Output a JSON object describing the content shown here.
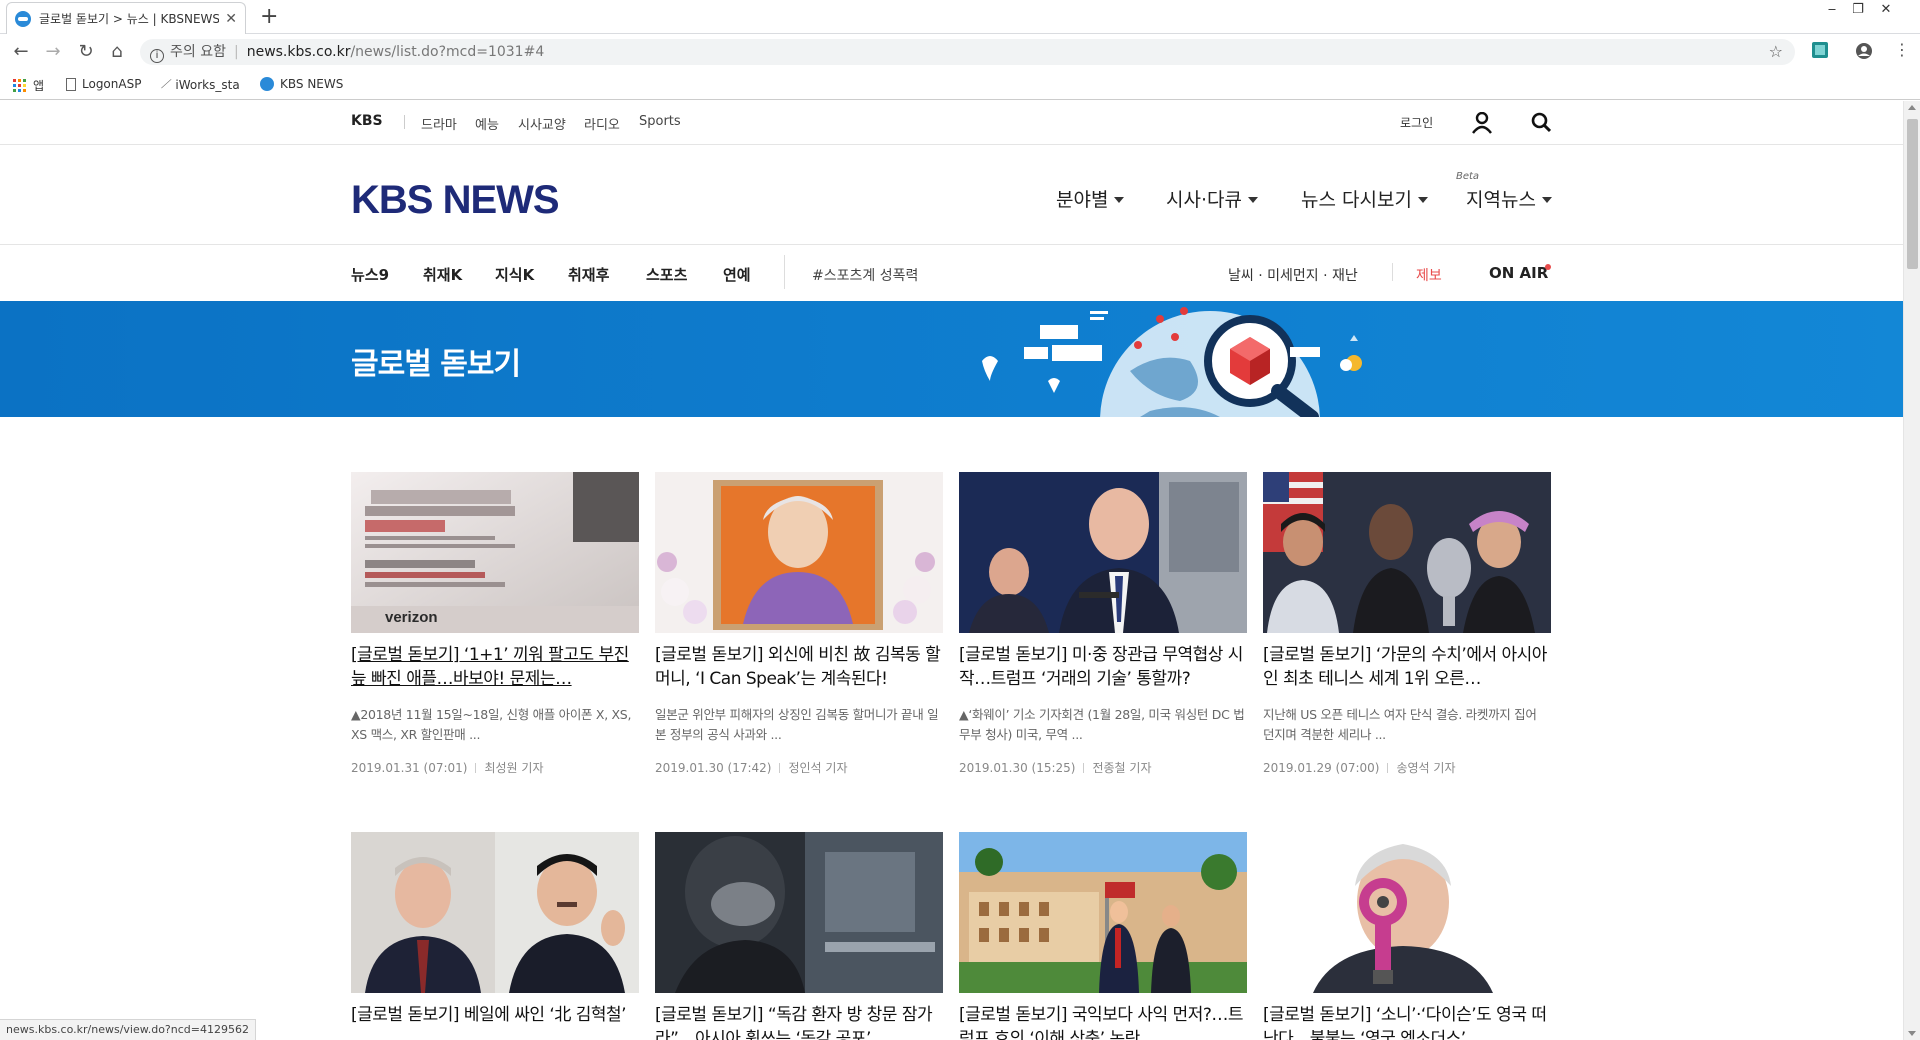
{
  "browser": {
    "tab_title": "글로벌 돋보기 > 뉴스 | KBSNEWS",
    "new_tab_symbol": "+",
    "url_warning": "주의 요함",
    "url_host": "news.kbs.co.kr",
    "url_path": "/news/list.do?mcd=1031#4",
    "bookmarks": [
      "앱",
      "LogonASP",
      "iWorks_sta",
      "KBS NEWS"
    ],
    "status_url": "news.kbs.co.kr/news/view.do?ncd=4129562"
  },
  "utility": {
    "brand": "KBS",
    "categories": [
      "드라마",
      "예능",
      "시사교양",
      "라디오",
      "Sports"
    ],
    "login": "로그인"
  },
  "brand": {
    "logo": "KBS NEWS",
    "main_nav": [
      "분야별",
      "시사·다큐",
      "뉴스 다시보기",
      "지역뉴스"
    ],
    "beta_label": "Beta"
  },
  "subnav": {
    "items": [
      "뉴스9",
      "취재K",
      "지식K",
      "취재후",
      "스포츠",
      "연예"
    ],
    "tag": "#스포츠계 성폭력",
    "weather": "날씨 · 미세먼지 · 재난",
    "report": "제보",
    "onair": "ON AIR"
  },
  "banner": {
    "title": "글로벌 돋보기"
  },
  "articles": [
    {
      "title": "[글로벌 돋보기] ‘1+1’ 끼워 팔고도 부진 늪 빠진 애플…바보야! 문제는…",
      "summary": "▲2018년 11월 15일~18일, 신형 애플 아이폰 X, XS, XS 맥스, XR 할인판매 ...",
      "date": "2019.01.31 (07:01)",
      "reporter": "최성원 기자"
    },
    {
      "title": "[글로벌 돋보기] 외신에 비친 故 김복동 할머니, ‘I Can Speak’는 계속된다!",
      "summary": "일본군 위안부 피해자의 상징인 김복동 할머니가 끝내 일본 정부의 공식 사과와 ...",
      "date": "2019.01.30 (17:42)",
      "reporter": "정인석 기자"
    },
    {
      "title": "[글로벌 돋보기] 미·중 장관급 무역협상 시작…트럼프 ‘거래의 기술’ 통할까?",
      "summary": "▲‘화웨이’ 기소 기자회견 (1월 28일, 미국 워싱턴 DC 법무부 청사) 미국, 무역 ...",
      "date": "2019.01.30 (15:25)",
      "reporter": "전종철 기자"
    },
    {
      "title": "[글로벌 돋보기] ‘가문의 수치’에서 아시아인 최초 테니스 세계 1위 오른…",
      "summary": "지난해 US 오픈 테니스 여자 단식 결승. 라켓까지 집어 던지며 격분한 세리나 ...",
      "date": "2019.01.29 (07:00)",
      "reporter": "송영석 기자"
    },
    {
      "title": "[글로벌 돋보기] 베일에 싸인 ‘北 김혁철’",
      "summary": "",
      "date": "",
      "reporter": ""
    },
    {
      "title": "[글로벌 돋보기] “독감 환자 방 창문 잠가라”…아시아 휩쓰는 ‘독감 공포’",
      "summary": "",
      "date": "",
      "reporter": ""
    },
    {
      "title": "[글로벌 돋보기] 국익보다 사익 먼저?…트럼프 호의 ‘이해 상충’ 논란",
      "summary": "",
      "date": "",
      "reporter": ""
    },
    {
      "title": "[글로벌 돋보기] ‘소니’·‘다이슨’도 영국 떠난다…불붙는 ‘영국 엑소더스’",
      "summary": "",
      "date": "",
      "reporter": ""
    }
  ]
}
